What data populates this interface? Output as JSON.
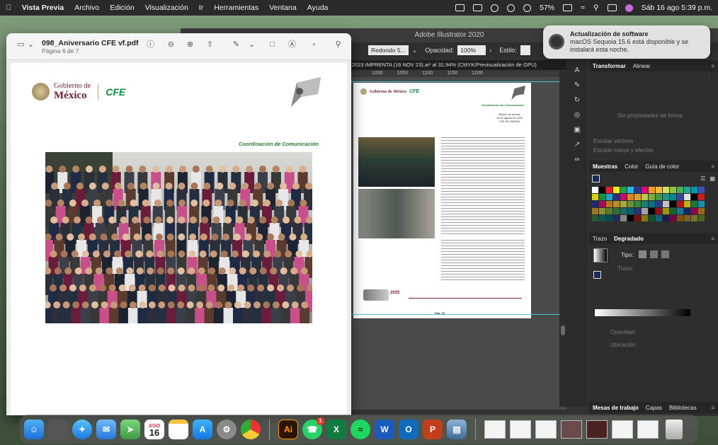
{
  "menubar": {
    "app": "Vista Previa",
    "items": [
      "Archivo",
      "Edición",
      "Visualización",
      "Ir",
      "Herramientas",
      "Ventana",
      "Ayuda"
    ],
    "battery": "57%",
    "datetime": "Sáb 16 ago 5:39 p.m."
  },
  "notification": {
    "title": "Actualización de software",
    "body": "macOS Sequoia 15.6 está disponible y se instalará esta noche."
  },
  "preview": {
    "title": "098_Aniversario CFE vf.pdf",
    "subtitle": "Página 6 de 7",
    "doc": {
      "gob_small": "Gobierno de",
      "gob_big": "México",
      "cfe": "CFE",
      "coordination": "Coordinación de Comunicación"
    }
  },
  "illustrator": {
    "title": "Adobe Illustrator 2020",
    "toolbar": {
      "stroke": "Redondo 5...",
      "opacity_label": "Opacidad:",
      "opacity_value": "100%",
      "style_label": "Estilo:"
    },
    "tab": "2023 IMPRENTA (16 NOV 23).ai* al 31.94% (CMYK/Previsualización de GPU)",
    "ruler": [
      "1000",
      "1050",
      "1100",
      "1150",
      "1200"
    ],
    "artboard": {
      "gob": "Gobierno de México",
      "cfe": "CFE",
      "coord": "Coordinación de Comunicación",
      "bulletin": "Boletín de prensa\n16 de agosto de 2025\nCFE BP 098/25vf",
      "year": "2025",
      "page": "Pag. 18"
    },
    "panels": {
      "transform_tab": "Transformar",
      "align_tab": "Alinear",
      "no_props": "Sin propiedades de forma",
      "scale_corners": "Escalar vértices",
      "scale_strokes": "Escalar trazos y efectos",
      "swatches_tabs": [
        "Muestras",
        "Color",
        "Guía de color"
      ],
      "gradient_tabs": [
        "Trazo",
        "Degradado"
      ],
      "type_label": "Tipo:",
      "stroke_label": "Trazo:",
      "opacity_label": "Opacidad:",
      "location_label": "Ubicación:",
      "bottom_tabs": [
        "Mesas de trabajo",
        "Capas",
        "Bibliotecas"
      ]
    }
  },
  "dock": {
    "calendar_month": "AGO",
    "calendar_day": "16",
    "whatsapp_badge": "1"
  }
}
